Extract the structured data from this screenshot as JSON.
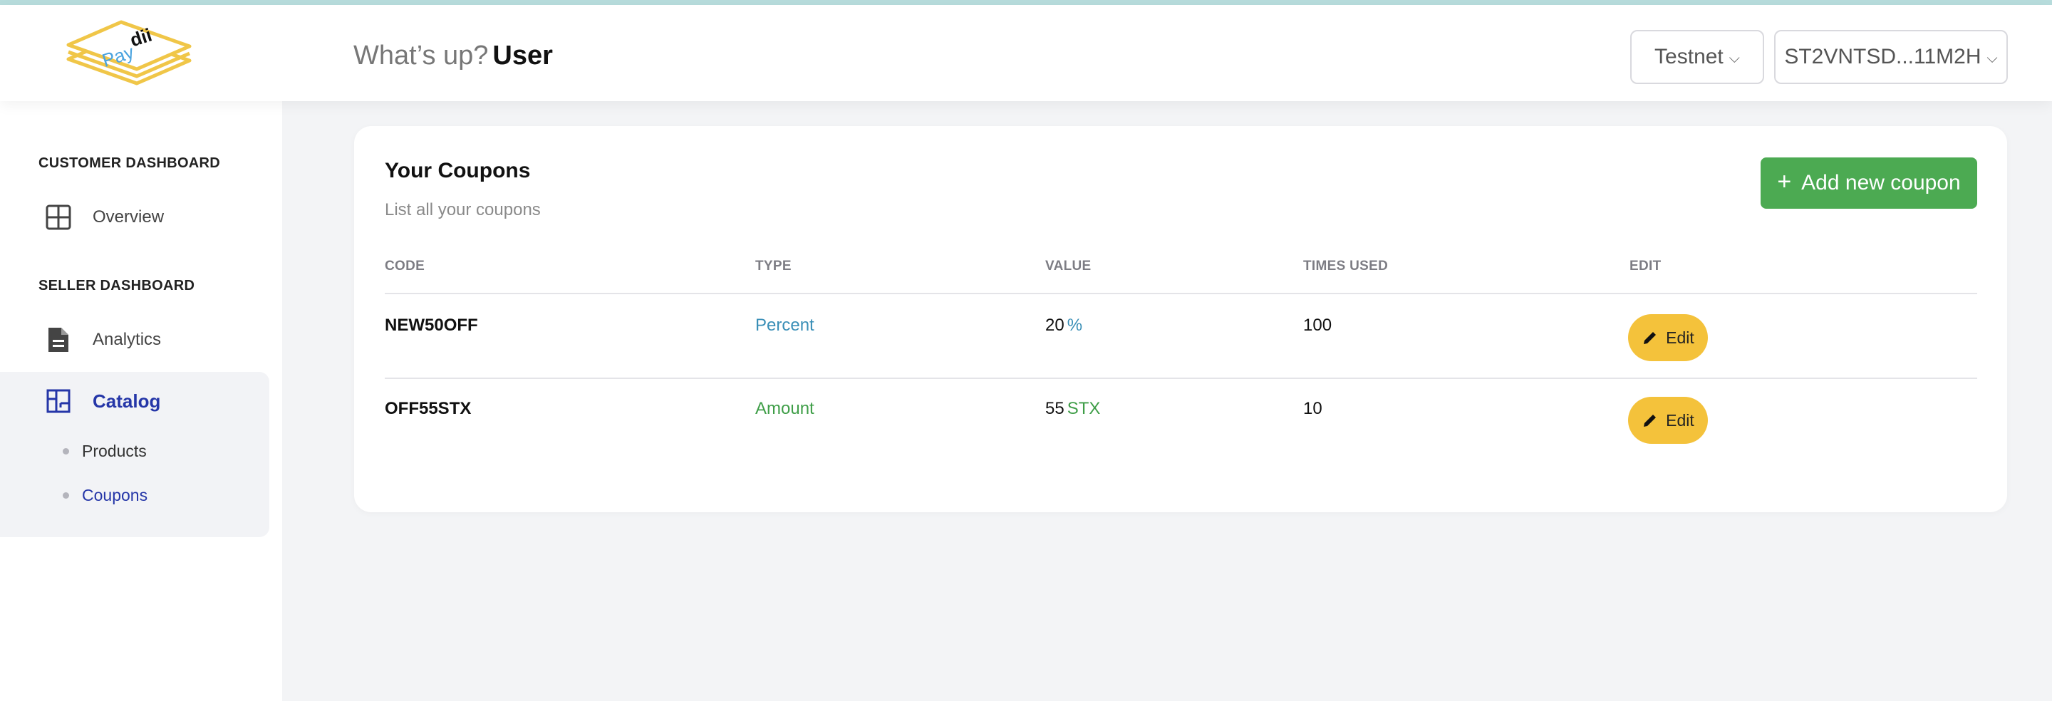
{
  "header": {
    "logo_text": "Paydii",
    "greeting": "What’s up?",
    "user_name": "User",
    "network_label": "Testnet",
    "wallet_label": "ST2VNTSD...11M2H"
  },
  "sidebar": {
    "customer_section": "CUSTOMER DASHBOARD",
    "overview_label": "Overview",
    "seller_section": "SELLER DASHBOARD",
    "analytics_label": "Analytics",
    "catalog_label": "Catalog",
    "products_label": "Products",
    "coupons_label": "Coupons"
  },
  "main": {
    "title": "Your Coupons",
    "subtitle": "List all your coupons",
    "add_button_label": "Add new coupon",
    "columns": [
      "CODE",
      "TYPE",
      "VALUE",
      "TIMES USED",
      "EDIT"
    ],
    "rows": [
      {
        "code": "NEW50OFF",
        "type": "Percent",
        "value": "20",
        "unit": "%",
        "times_used": "100",
        "edit": "Edit"
      },
      {
        "code": "OFF55STX",
        "type": "Amount",
        "value": "55",
        "unit": "STX",
        "times_used": "10",
        "edit": "Edit"
      }
    ]
  },
  "colors": {
    "accent_green": "#4caa52",
    "edit_yellow": "#f4c23b",
    "active_blue": "#2536a8",
    "percent_blue": "#3a8fb7",
    "amount_green": "#3f9e48"
  }
}
